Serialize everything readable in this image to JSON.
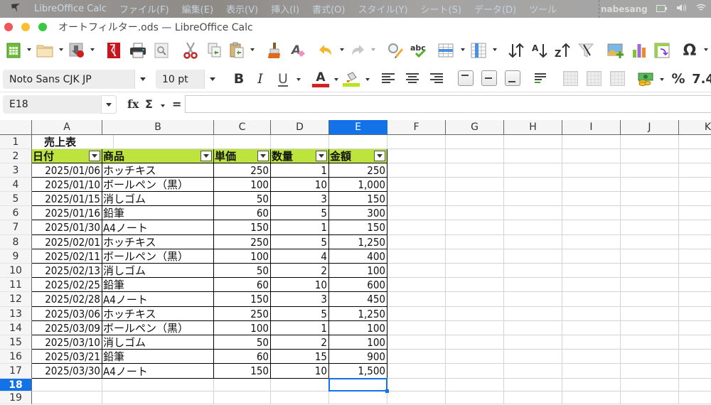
{
  "menubar": {
    "app_name": "LibreOffice Calc",
    "items": [
      "ファイル(F)",
      "編集(E)",
      "表示(V)",
      "挿入(I)",
      "書式(O)",
      "スタイル(Y)",
      "シート(S)",
      "データ(D)",
      "ツール"
    ],
    "user": "nabesang",
    "status_icons": [
      "battery-charging-icon",
      "volume-icon",
      "wifi-icon"
    ]
  },
  "window": {
    "title": "オートフィルター.ods — LibreOffice Calc"
  },
  "toolbar_standard": {
    "buttons": [
      "new",
      "open",
      "save",
      "export-pdf",
      "print",
      "print-preview",
      "cut",
      "copy",
      "paste",
      "clone-formatting",
      "clear-formatting",
      "undo",
      "redo",
      "find-replace",
      "spelling",
      "row",
      "column",
      "sort",
      "sort-ascending",
      "sort-descending",
      "autofilter",
      "image",
      "chart",
      "pivot-table",
      "special-character"
    ]
  },
  "toolbar_formatting": {
    "font_name": "Noto Sans CJK JP",
    "font_size": "10 pt",
    "bold": "B",
    "italic": "I",
    "underline": "U",
    "font_color_letter": "A",
    "font_color": "#d42020",
    "highlight_color": "#b5e61d",
    "percent": "%",
    "number_format": "7.4"
  },
  "formula_bar": {
    "name_box": "E18",
    "fx": "fx",
    "sigma": "Σ",
    "equals": "=",
    "formula": ""
  },
  "sheet": {
    "columns": [
      "A",
      "B",
      "C",
      "D",
      "E",
      "F",
      "G",
      "H",
      "I",
      "J",
      "K"
    ],
    "selected_column": "E",
    "rows": [
      "1",
      "2",
      "3",
      "4",
      "5",
      "6",
      "7",
      "8",
      "9",
      "10",
      "11",
      "12",
      "13",
      "14",
      "15",
      "16",
      "17",
      "18",
      "19"
    ],
    "selected_row": "18",
    "title": "売上表",
    "headers": [
      "日付",
      "商品",
      "単価",
      "数量",
      "金額"
    ],
    "header_color": "#bde33d",
    "data": [
      [
        "2025/01/06",
        "ホッチキス",
        "250",
        "1",
        "250"
      ],
      [
        "2025/01/10",
        "ボールペン（黒）",
        "100",
        "10",
        "1,000"
      ],
      [
        "2025/01/15",
        "消しゴム",
        "50",
        "3",
        "150"
      ],
      [
        "2025/01/16",
        "鉛筆",
        "60",
        "5",
        "300"
      ],
      [
        "2025/01/30",
        "A4ノート",
        "150",
        "1",
        "150"
      ],
      [
        "2025/02/01",
        "ホッチキス",
        "250",
        "5",
        "1,250"
      ],
      [
        "2025/02/11",
        "ボールペン（黒）",
        "100",
        "4",
        "400"
      ],
      [
        "2025/02/13",
        "消しゴム",
        "50",
        "2",
        "100"
      ],
      [
        "2025/02/25",
        "鉛筆",
        "60",
        "10",
        "600"
      ],
      [
        "2025/02/28",
        "A4ノート",
        "150",
        "3",
        "450"
      ],
      [
        "2025/03/06",
        "ホッチキス",
        "250",
        "5",
        "1,250"
      ],
      [
        "2025/03/09",
        "ボールペン（黒）",
        "100",
        "1",
        "100"
      ],
      [
        "2025/03/10",
        "消しゴム",
        "50",
        "2",
        "100"
      ],
      [
        "2025/03/21",
        "鉛筆",
        "60",
        "15",
        "900"
      ],
      [
        "2025/03/30",
        "A4ノート",
        "150",
        "10",
        "1,500"
      ]
    ],
    "active_cell": "E18",
    "selection_color": "#1472e8"
  }
}
